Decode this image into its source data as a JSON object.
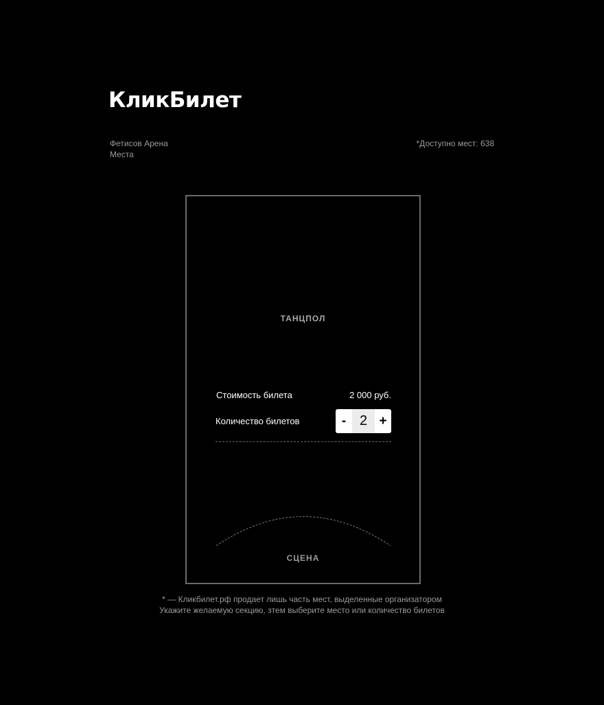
{
  "header": {
    "logo": "КликБилет",
    "venue": "Фетисов Арена",
    "section": "Места",
    "available": "*Доступно мест: 638"
  },
  "map": {
    "dancefloor": "ТАНЦПОЛ",
    "stage": "СЦЕНА"
  },
  "ticket": {
    "price_label": "Стоимость билета",
    "price_value": "2 000 руб.",
    "quantity_label": "Количество билетов",
    "decrement": "-",
    "quantity": "2",
    "increment": "+"
  },
  "footer": {
    "note": "* — Кликбилет.рф продает лишь часть мест, выделенные организатором",
    "hint": "Укажите желаемую секцию, зтем выберите место или количество билетов"
  }
}
